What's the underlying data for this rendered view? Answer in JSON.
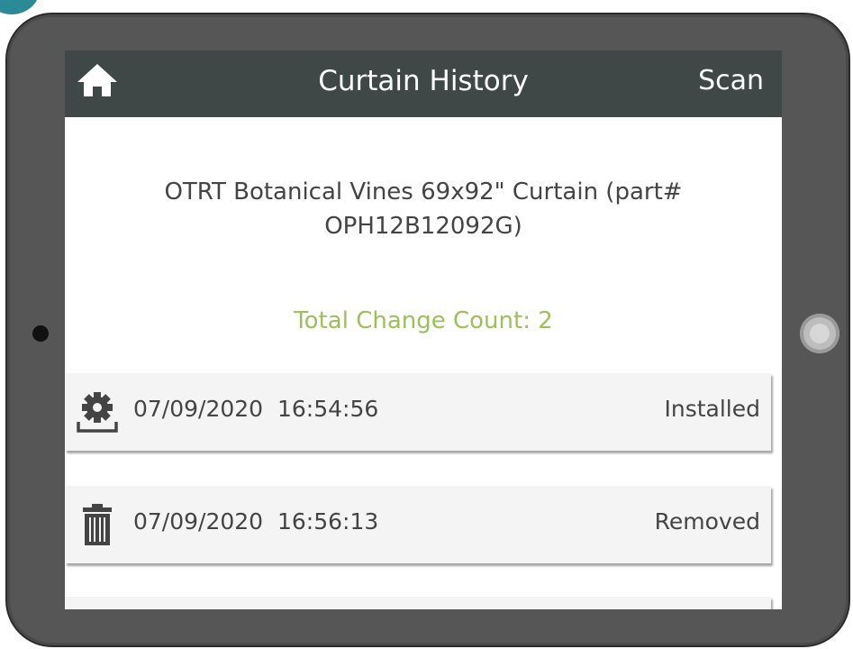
{
  "header": {
    "title": "Curtain History",
    "scan_label": "Scan",
    "home_icon": "home-icon"
  },
  "product": {
    "name": "OTRT Botanical Vines 69x92\" Curtain (part# OPH12B12092G)"
  },
  "summary": {
    "change_count": "Total Change Count: 2"
  },
  "history": [
    {
      "icon": "install-gear-icon",
      "datetime": "07/09/2020  16:54:56",
      "status": "Installed"
    },
    {
      "icon": "trash-icon",
      "datetime": "07/09/2020  16:56:13",
      "status": "Removed"
    }
  ],
  "colors": {
    "header_bg": "#3f4747",
    "accent_green": "#9cc05a",
    "tablet_frame": "#565656",
    "text": "#444444"
  }
}
